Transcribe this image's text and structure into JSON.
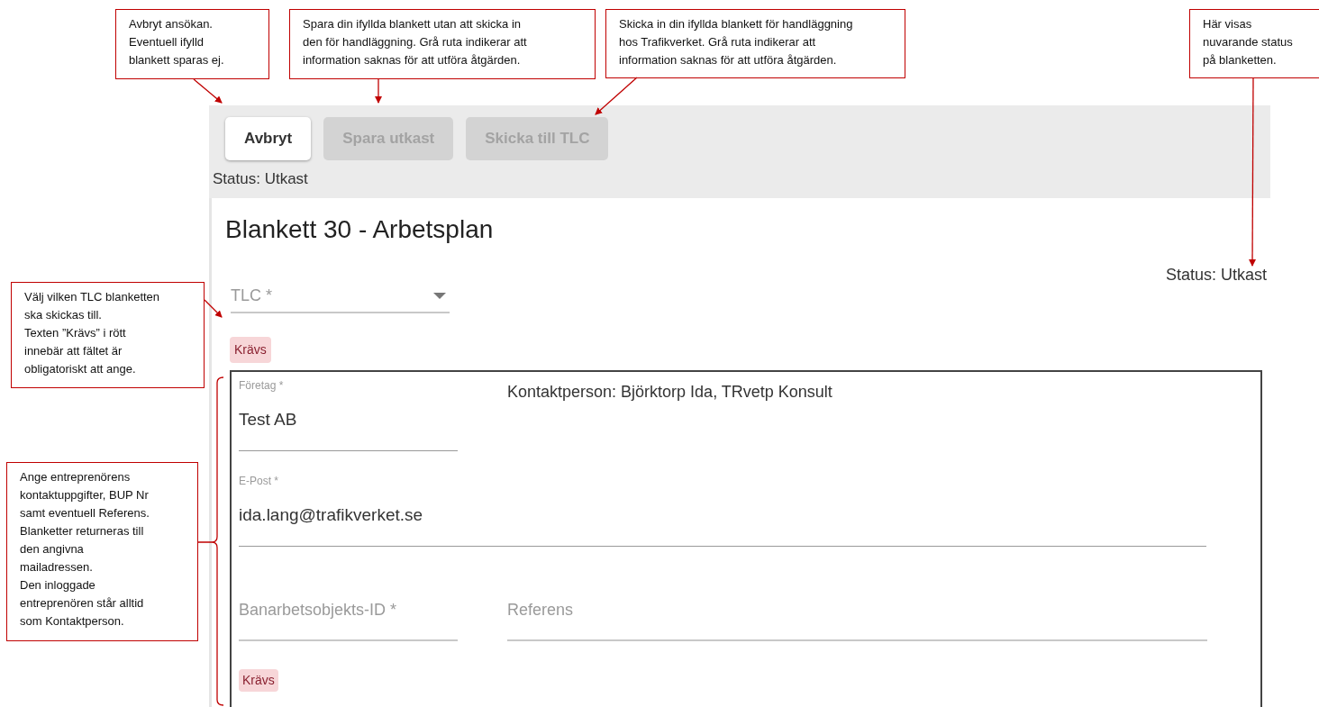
{
  "callouts": [
    {
      "text": "Avbryt ansökan.\nEventuell ifylld\nblankett sparas ej."
    },
    {
      "text": "Spara din ifyllda blankett utan att skicka in\nden för handläggning. Grå ruta indikerar att\ninformation saknas för att utföra åtgärden."
    },
    {
      "text": "Skicka in din ifyllda blankett för handläggning\nhos Trafikverket. Grå ruta indikerar att\ninformation saknas för att utföra åtgärden."
    },
    {
      "text": "Här visas\nnuvarande status\npå blanketten."
    },
    {
      "text": "Välj vilken TLC blanketten\nska skickas till.\nTexten ”Krävs” i rött\ninnebär att fältet är\nobligatoriskt att ange."
    },
    {
      "text": "Ange entreprenörens\nkontaktuppgifter, BUP Nr\nsamt eventuell Referens.\nBlanketter returneras till\nden angivna\nmailadressen.\nDen inloggade\nentreprenören står alltid\nsom Kontaktperson."
    }
  ],
  "toolbar": {
    "buttons": [
      {
        "label": "Avbryt",
        "disabled": false
      },
      {
        "label": "Spara utkast",
        "disabled": true
      },
      {
        "label": "Skicka till TLC",
        "disabled": true
      }
    ],
    "status": "Status: Utkast"
  },
  "form": {
    "title": "Blankett 30 - Arbetsplan",
    "status": "Status: Utkast",
    "tlc_select": {
      "placeholder": "TLC *",
      "error": "Krävs"
    },
    "contact": {
      "company": {
        "label": "Företag *",
        "value": "Test AB"
      },
      "contact_person": "Kontaktperson: Björktorp Ida, TRvetp Konsult",
      "email": {
        "label": "E-Post *",
        "value": "ida.lang@trafikverket.se"
      },
      "object_id": {
        "placeholder": "Banarbetsobjekts-ID *",
        "error": "Krävs"
      },
      "reference": {
        "placeholder": "Referens"
      }
    }
  }
}
